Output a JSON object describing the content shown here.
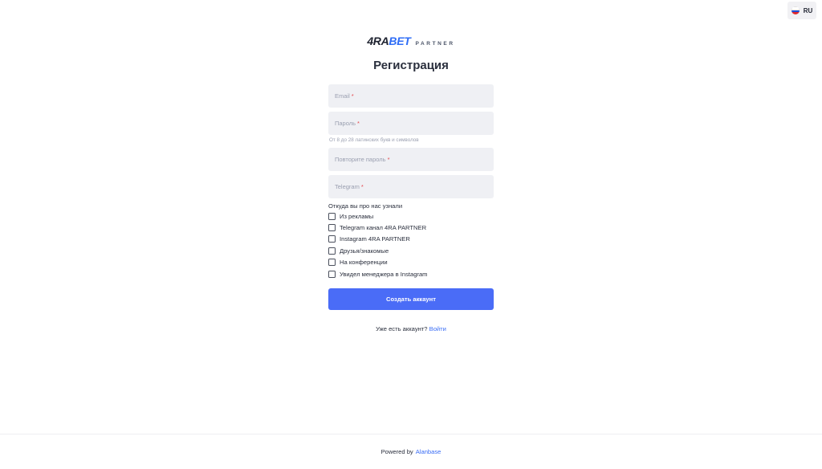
{
  "language": {
    "code": "RU",
    "flag": "russia-flag-icon"
  },
  "logo": {
    "brand_main": "4RA",
    "brand_accent": "BET",
    "brand_sub": "PARTNER"
  },
  "title": "Регистрация",
  "form": {
    "email_placeholder": "Email",
    "password_placeholder": "Пароль",
    "password_hint": "От 8 до 28 латинских букв и символов",
    "repeat_password_placeholder": "Повторите пароль",
    "telegram_placeholder": "Telegram",
    "required_mark": "*",
    "source_label": "Откуда вы про нас узнали",
    "source_options": [
      "Из рекламы",
      "Telegram канал 4RA PARTNER",
      "Instagram 4RA PARTNER",
      "Друзья/знакомые",
      "На конференции",
      "Увидел менеджера в Instagram"
    ],
    "submit_label": "Создать аккаунт"
  },
  "login": {
    "prompt": "Уже есть аккаунт?",
    "link": "Войти"
  },
  "footer": {
    "powered_by": "Powered by",
    "vendor": "Alanbase"
  },
  "colors": {
    "accent": "#4a6cf7",
    "field_bg": "#eff0f4",
    "required": "#e5484d",
    "link": "#3b6ef5"
  }
}
